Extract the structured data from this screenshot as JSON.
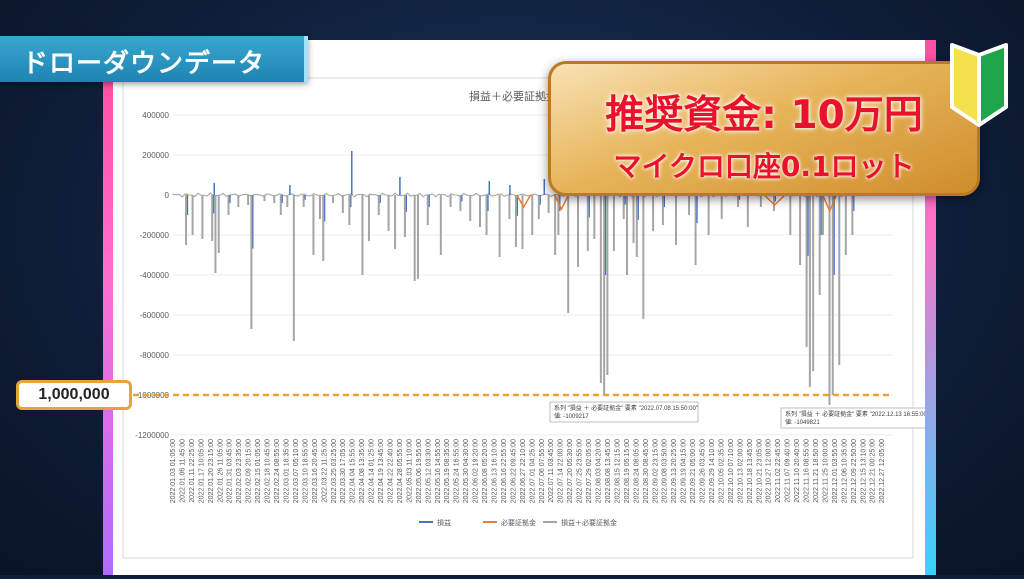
{
  "header": {
    "title": "ドローダウンデータ"
  },
  "promo": {
    "line1": "推奨資金: 10万円",
    "line2": "マイクロ口座0.1ロット"
  },
  "callout": {
    "label": "1,000,000"
  },
  "colors": {
    "pnl": "#4472c4",
    "margin": "#ed7d31",
    "combined": "#a5a5a5",
    "threshold": "#f0a030"
  },
  "chart_data": {
    "type": "line",
    "title": "損益＋必要証拠金",
    "ylim": [
      -1200000,
      400000
    ],
    "yticks": [
      400000,
      200000,
      0,
      -200000,
      -400000,
      -600000,
      -800000,
      -1000000,
      -1200000
    ],
    "ytick_labels": [
      "400000",
      "200000",
      "0",
      "-200000",
      "-400000",
      "-600000",
      "-800000",
      "-1000000",
      "-1200000"
    ],
    "xticks": [
      "2022.01.03 01:05:00",
      "2022.01.06 11:45:00",
      "2022.01.11 22:25:00",
      "2022.01.17 10:05:00",
      "2022.01.20 23:15:00",
      "2022.01.26 11:05:00",
      "2022.01.31 03:45:00",
      "2022.02.03 23:35:00",
      "2022.02.09 20:15:00",
      "2022.02.15 01:05:00",
      "2022.02.18 10:45:00",
      "2022.02.24 08:55:00",
      "2022.03.01 18:35:00",
      "2022.03.07 05:10:00",
      "2022.03.10 18:55:00",
      "2022.03.16 20:45:00",
      "2022.03.22 11:25:00",
      "2022.03.25 03:25:00",
      "2022.03.30 17:05:00",
      "2022.04.04 15:55:00",
      "2022.04.08 13:35:00",
      "2022.04.14 01:25:00",
      "2022.04.19 13:45:00",
      "2022.04.22 22:40:00",
      "2022.04.28 05:55:00",
      "2022.05.03 11:10:00",
      "2022.05.06 19:55:00",
      "2022.05.12 03:30:00",
      "2022.05.16 14:55:00",
      "2022.05.19 08:35:00",
      "2022.05.24 16:55:00",
      "2022.05.30 04:30:00",
      "2022.06.02 19:20:00",
      "2022.06.08 05:20:00",
      "2022.06.13 16:10:00",
      "2022.06.16 22:55:00",
      "2022.06.22 09:45:00",
      "2022.06.27 22:10:00",
      "2022.07.01 04:25:00",
      "2022.07.06 07:55:00",
      "2022.07.11 03:45:00",
      "2022.07.14 22:00:00",
      "2022.07.20 05:30:00",
      "2022.07.25 23:55:00",
      "2022.07.29 02:05:00",
      "2022.08.03 04:20:00",
      "2022.08.08 13:45:00",
      "2022.08.15 12:15:00",
      "2022.08.19 05:15:00",
      "2022.08.24 08:05:00",
      "2022.08.30 08:45:00",
      "2022.09.02 23:15:00",
      "2022.09.08 03:50:00",
      "2022.09.13 20:25:00",
      "2022.09.19 04:15:00",
      "2022.09.21 05:00:00",
      "2022.09.26 03:45:00",
      "2022.09.29 14:10:00",
      "2022.10.05 02:35:00",
      "2022.10.10 07:10:00",
      "2022.10.13 02:00:00",
      "2022.10.18 13:45:00",
      "2022.10.21 23:05:00",
      "2022.10.27 12:00:00",
      "2022.11.02 22:45:00",
      "2022.11.07 09:40:00",
      "2022.11.10 20:40:00",
      "2022.11.16 08:55:00",
      "2022.11.21 18:50:00",
      "2022.11.25 10:00:00",
      "2022.12.01 03:55:00",
      "2022.12.06 10:35:00",
      "2022.12.09 22:50:00",
      "2022.12.15 13:10:00",
      "2022.12.21 00:25:00",
      "2022.12.27 12:05:00"
    ],
    "threshold": -1000000,
    "series": [
      {
        "name": "損益",
        "color": "#4472c4"
      },
      {
        "name": "必要証拠金",
        "color": "#ed7d31"
      },
      {
        "name": "損益＋必要証拠金",
        "color": "#a5a5a5"
      }
    ],
    "spikes": [
      [
        0.02,
        -250000
      ],
      [
        0.03,
        -200000
      ],
      [
        0.045,
        -220000
      ],
      [
        0.06,
        -230000
      ],
      [
        0.065,
        -390000
      ],
      [
        0.07,
        -290000
      ],
      [
        0.085,
        -100000
      ],
      [
        0.1,
        -60000
      ],
      [
        0.115,
        -50000
      ],
      [
        0.12,
        -670000
      ],
      [
        0.14,
        -30000
      ],
      [
        0.155,
        -40000
      ],
      [
        0.165,
        -100000
      ],
      [
        0.175,
        -60000
      ],
      [
        0.185,
        -730000
      ],
      [
        0.2,
        -60000
      ],
      [
        0.215,
        -300000
      ],
      [
        0.225,
        -120000
      ],
      [
        0.23,
        -330000
      ],
      [
        0.245,
        -40000
      ],
      [
        0.26,
        -90000
      ],
      [
        0.27,
        -150000
      ],
      [
        0.29,
        -400000
      ],
      [
        0.3,
        -230000
      ],
      [
        0.315,
        -100000
      ],
      [
        0.33,
        -180000
      ],
      [
        0.34,
        -270000
      ],
      [
        0.355,
        -210000
      ],
      [
        0.37,
        -430000
      ],
      [
        0.375,
        -420000
      ],
      [
        0.39,
        -150000
      ],
      [
        0.41,
        -300000
      ],
      [
        0.425,
        -60000
      ],
      [
        0.44,
        -80000
      ],
      [
        0.455,
        -130000
      ],
      [
        0.47,
        -160000
      ],
      [
        0.48,
        -200000
      ],
      [
        0.5,
        -310000
      ],
      [
        0.515,
        -120000
      ],
      [
        0.525,
        -260000
      ],
      [
        0.535,
        -270000
      ],
      [
        0.55,
        -200000
      ],
      [
        0.56,
        -120000
      ],
      [
        0.575,
        -90000
      ],
      [
        0.585,
        -300000
      ],
      [
        0.59,
        -200000
      ],
      [
        0.605,
        -590000
      ],
      [
        0.62,
        -360000
      ],
      [
        0.635,
        -280000
      ],
      [
        0.645,
        -220000
      ],
      [
        0.655,
        -940000
      ],
      [
        0.66,
        -1000000
      ],
      [
        0.665,
        -900000
      ],
      [
        0.675,
        -280000
      ],
      [
        0.69,
        -120000
      ],
      [
        0.695,
        -400000
      ],
      [
        0.705,
        -240000
      ],
      [
        0.71,
        -310000
      ],
      [
        0.72,
        -620000
      ],
      [
        0.735,
        -180000
      ],
      [
        0.75,
        -150000
      ],
      [
        0.77,
        -250000
      ],
      [
        0.79,
        -100000
      ],
      [
        0.8,
        -350000
      ],
      [
        0.82,
        -200000
      ],
      [
        0.84,
        -120000
      ],
      [
        0.865,
        -60000
      ],
      [
        0.88,
        -160000
      ],
      [
        0.9,
        -60000
      ],
      [
        0.92,
        -80000
      ],
      [
        0.945,
        -200000
      ],
      [
        0.96,
        -350000
      ],
      [
        0.97,
        -760000
      ],
      [
        0.975,
        -960000
      ],
      [
        0.98,
        -880000
      ],
      [
        0.99,
        -500000
      ],
      [
        0.995,
        -200000
      ],
      [
        1.005,
        -1050000
      ],
      [
        1.01,
        -1000000
      ],
      [
        1.02,
        -850000
      ],
      [
        1.03,
        -300000
      ],
      [
        1.04,
        -200000
      ]
    ],
    "annotations": [
      {
        "text1": "系列 \"損益 ＋ 必要証拠金\" 要素 \"2022.07.08 15:50:00\"",
        "text2": "値: -1009217"
      },
      {
        "text1": "系列 \"損益 ＋ 必要証拠金\" 要素 \"2022.12.13 16:55:00\"",
        "text2": "値: -1049821"
      }
    ],
    "legend_position": "bottom"
  }
}
